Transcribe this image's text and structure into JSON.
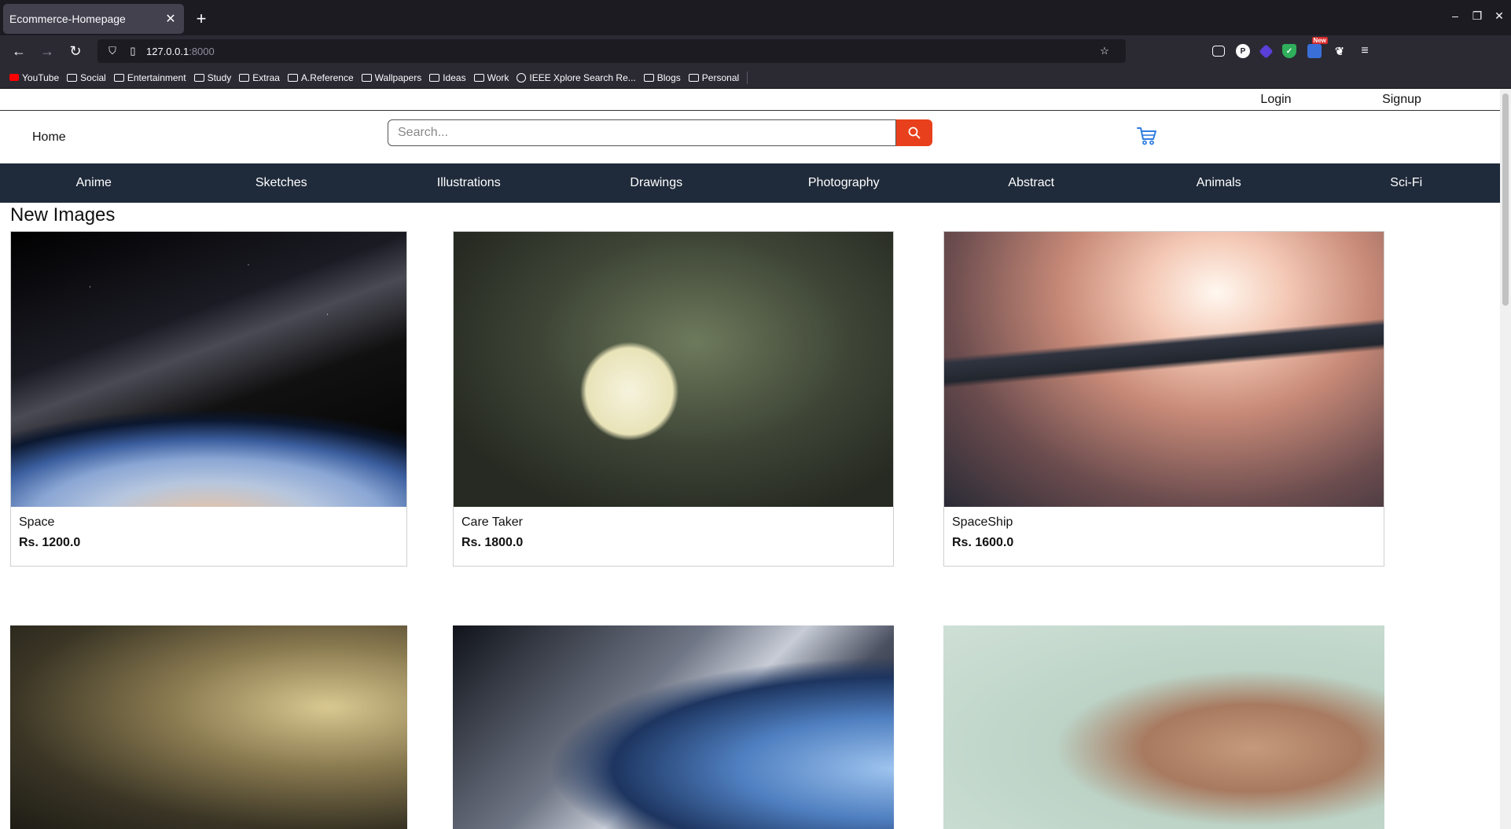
{
  "browser": {
    "tab_title": "Ecommerce-Homepage",
    "url_host": "127.0.0.1",
    "url_port": ":8000",
    "bookmarks": [
      "YouTube",
      "Social",
      "Entertainment",
      "Study",
      "Extraa",
      "A.Reference",
      "Wallpapers",
      "Ideas",
      "Work",
      "IEEE Xplore Search Re...",
      "Blogs",
      "Personal"
    ],
    "extension_badge": "New"
  },
  "top_links": {
    "login": "Login",
    "signup": "Signup"
  },
  "header": {
    "home": "Home",
    "search_placeholder": "Search..."
  },
  "categories": [
    "Anime",
    "Sketches",
    "Illustrations",
    "Drawings",
    "Photography",
    "Abstract",
    "Animals",
    "Sci-Fi"
  ],
  "section_title": "New Images",
  "products": [
    {
      "name": "Space",
      "price": "Rs. 1200.0"
    },
    {
      "name": "Care Taker",
      "price": "Rs. 1800.0"
    },
    {
      "name": "SpaceShip",
      "price": "Rs. 1600.0"
    }
  ],
  "colors": {
    "accent": "#e8401c",
    "catbar": "#1f2a3a",
    "cart": "#2f7de1"
  }
}
